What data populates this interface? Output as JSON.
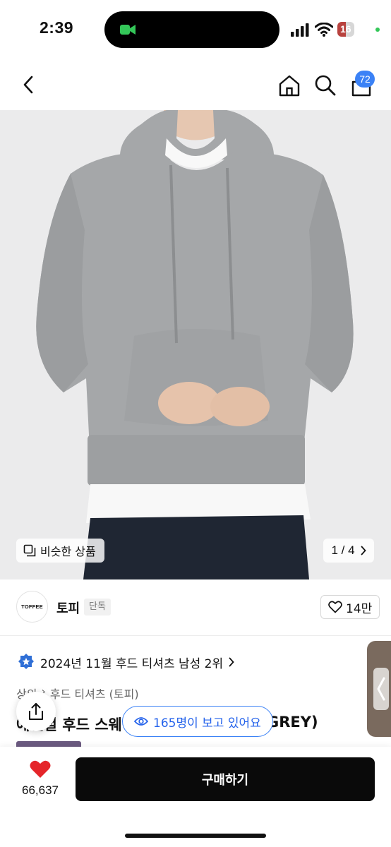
{
  "status_bar": {
    "time": "2:39",
    "battery": "16"
  },
  "nav": {
    "cart_count": "72"
  },
  "hero": {
    "similar_label": "비슷한 상품",
    "pager_text": "1 / 4",
    "sweatshirt_color": "#a5a7a9",
    "background_color": "#ebebec"
  },
  "store": {
    "logo_text": "TOFFEE",
    "name": "토피",
    "tag": "단독",
    "likes": "14만"
  },
  "ranking": {
    "text": "2024년 11월 후드 티셔츠 남성 2위"
  },
  "product": {
    "breadcrumb_a": "상의",
    "breadcrumb_b": "후드 티셔츠 (토피)",
    "title_visible": "에센셜 후드 스웨",
    "title_tail": "GREY)"
  },
  "viewers": {
    "text": "165명이 보고 있어요"
  },
  "bottom": {
    "fav_count": "66,637",
    "buy_label": "구매하기"
  },
  "colors": {
    "accent_blue": "#3b82f6",
    "heart_red": "#e5252a",
    "buy_black": "#0a0a0a"
  }
}
